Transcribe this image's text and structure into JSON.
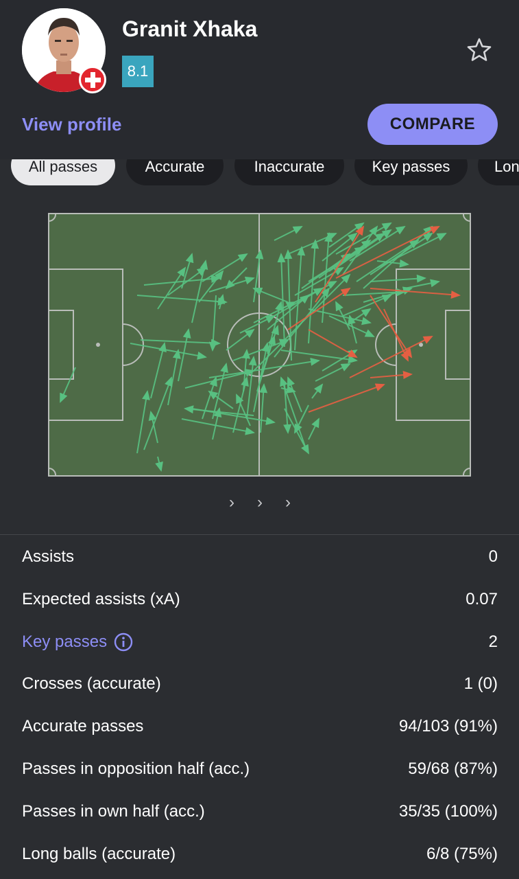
{
  "player": {
    "name": "Granit Xhaka",
    "rating": "8.1"
  },
  "actions": {
    "view_profile": "View profile",
    "compare": "COMPARE"
  },
  "tabs": [
    "All passes",
    "Accurate",
    "Inaccurate",
    "Key passes",
    "Long balls"
  ],
  "colors": {
    "accurate": "#58c081",
    "inaccurate": "#e45f43",
    "pitch": "#4e6b47",
    "accent": "#8d8ef5",
    "rating": "#3aa5be"
  },
  "stats": [
    {
      "label": "Assists",
      "value": "0"
    },
    {
      "label": "Expected assists (xA)",
      "value": "0.07"
    },
    {
      "label": "Key passes",
      "value": "2"
    },
    {
      "label": "Crosses (accurate)",
      "value": "1 (0)"
    },
    {
      "label": "Accurate passes",
      "value": "94/103 (91%)"
    },
    {
      "label": "Passes in opposition half (acc.)",
      "value": "59/68 (87%)"
    },
    {
      "label": "Passes in own half (acc.)",
      "value": "35/35 (100%)"
    },
    {
      "label": "Long balls (accurate)",
      "value": "6/8 (75%)"
    }
  ]
}
